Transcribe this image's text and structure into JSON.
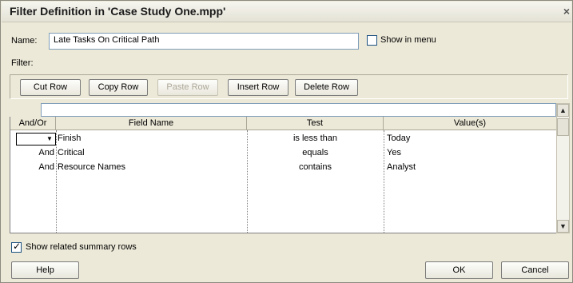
{
  "dialog": {
    "title": "Filter Definition in 'Case Study One.mpp'",
    "close_glyph": "×"
  },
  "name_label": "Name:",
  "name_value": "Late Tasks On Critical Path",
  "show_in_menu": {
    "label": "Show in menu",
    "checked": false
  },
  "filter_label": "Filter:",
  "toolbar": {
    "cut_row": "Cut Row",
    "copy_row": "Copy Row",
    "paste_row": "Paste Row",
    "insert_row": "Insert Row",
    "delete_row": "Delete Row"
  },
  "grid": {
    "columns": [
      "And/Or",
      "Field Name",
      "Test",
      "Value(s)"
    ],
    "rows": [
      {
        "andor": "",
        "field": "Finish",
        "test": "is less than",
        "value": "Today"
      },
      {
        "andor": "And",
        "field": "Critical",
        "test": "equals",
        "value": "Yes"
      },
      {
        "andor": "And",
        "field": "Resource Names",
        "test": "contains",
        "value": "Analyst"
      }
    ]
  },
  "show_related": {
    "label": "Show related summary rows",
    "checked": true
  },
  "buttons": {
    "help": "Help",
    "ok": "OK",
    "cancel": "Cancel"
  },
  "icons": {
    "scroll_up": "▲",
    "scroll_down": "▼",
    "dropdown": "▼"
  }
}
